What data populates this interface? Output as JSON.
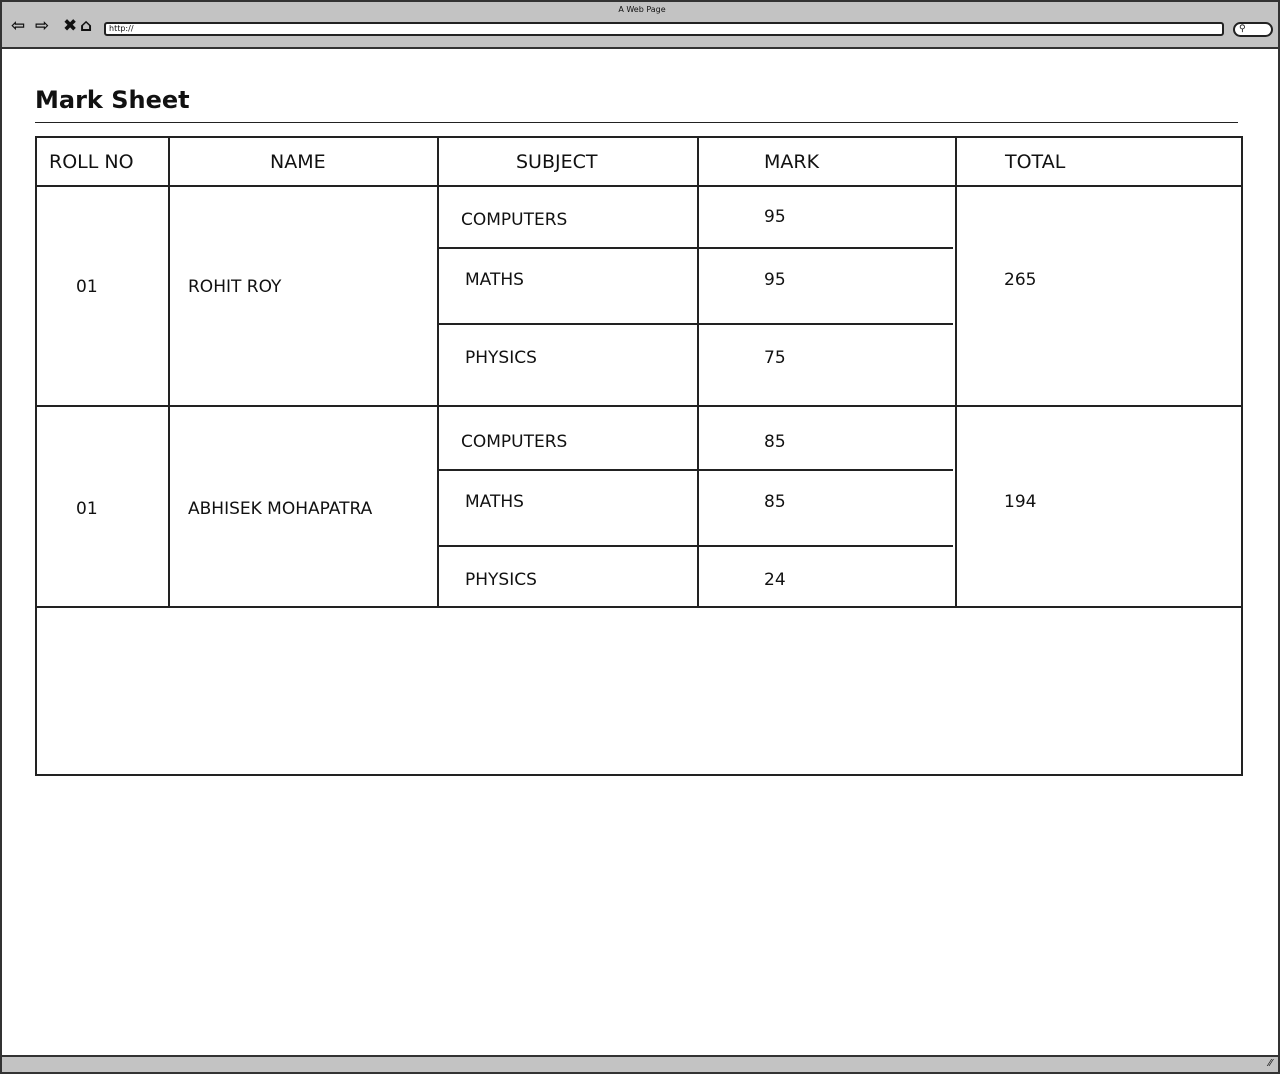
{
  "browser": {
    "title": "A Web Page",
    "url": "http://",
    "icons": [
      "back-arrow-icon",
      "forward-arrow-icon",
      "close-x-icon",
      "home-icon",
      "search-icon"
    ]
  },
  "page": {
    "heading": "Mark Sheet"
  },
  "table": {
    "headers": [
      "ROLL NO",
      "NAME",
      "SUBJECT",
      "MARK",
      "TOTAL"
    ],
    "rows": [
      {
        "roll": "01",
        "name": "ROHIT ROY",
        "total": "265",
        "subjects": [
          {
            "subject": "COMPUTERS",
            "mark": "95"
          },
          {
            "subject": "MATHS",
            "mark": "95"
          },
          {
            "subject": "PHYSICS",
            "mark": "75"
          }
        ]
      },
      {
        "roll": "01",
        "name": "ABHISEK MOHAPATRA",
        "total": "194",
        "subjects": [
          {
            "subject": "COMPUTERS",
            "mark": "85"
          },
          {
            "subject": "MATHS",
            "mark": "85"
          },
          {
            "subject": "PHYSICS",
            "mark": "24"
          }
        ]
      }
    ]
  }
}
